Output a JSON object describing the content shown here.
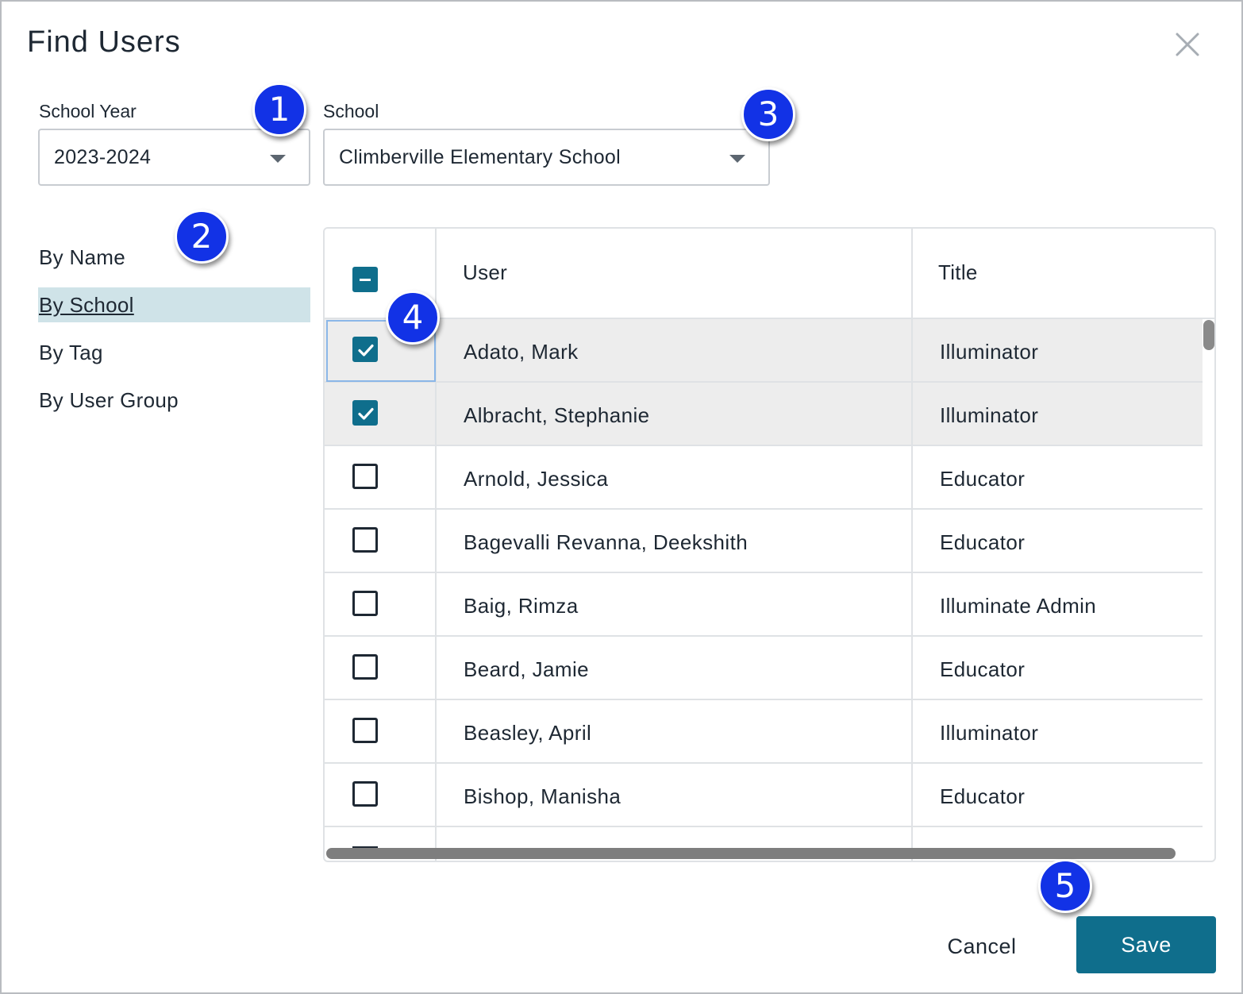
{
  "dialog": {
    "title": "Find Users",
    "close_icon": "close-icon"
  },
  "filters": {
    "school_year": {
      "label": "School Year",
      "value": "2023-2024"
    },
    "school": {
      "label": "School",
      "value": "Climberville Elementary School"
    }
  },
  "nav": {
    "items": [
      {
        "label": "By Name",
        "active": false
      },
      {
        "label": "By School",
        "active": true
      },
      {
        "label": "By Tag",
        "active": false
      },
      {
        "label": "By User Group",
        "active": false
      }
    ]
  },
  "table": {
    "columns": {
      "user": "User",
      "title": "Title"
    },
    "header_checkbox": "indeterminate",
    "rows": [
      {
        "user": "Adato, Mark",
        "title": "Illuminator",
        "checked": true
      },
      {
        "user": "Albracht, Stephanie",
        "title": "Illuminator",
        "checked": true
      },
      {
        "user": "Arnold, Jessica",
        "title": "Educator",
        "checked": false
      },
      {
        "user": "Bagevalli Revanna, Deekshith",
        "title": "Educator",
        "checked": false
      },
      {
        "user": "Baig, Rimza",
        "title": "Illuminate Admin",
        "checked": false
      },
      {
        "user": "Beard, Jamie",
        "title": "Educator",
        "checked": false
      },
      {
        "user": "Beasley, April",
        "title": "Illuminator",
        "checked": false
      },
      {
        "user": "Bishop, Manisha",
        "title": "Educator",
        "checked": false
      }
    ]
  },
  "footer": {
    "cancel_label": "Cancel",
    "save_label": "Save"
  },
  "markers": [
    "1",
    "2",
    "3",
    "4",
    "5"
  ],
  "colors": {
    "accent": "#0f6e8c",
    "active_nav_bg": "#cfe3e8",
    "selected_row_bg": "#ededed",
    "marker_blue": "#1232e6"
  }
}
